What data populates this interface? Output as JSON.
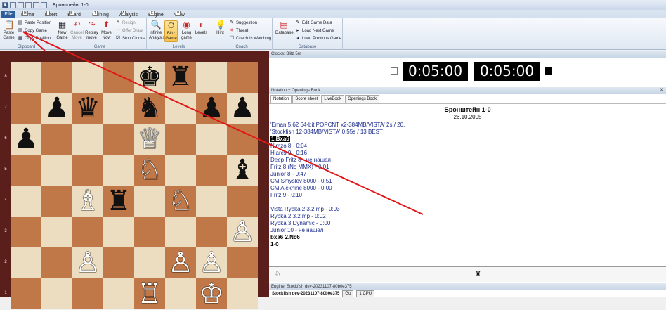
{
  "app": {
    "title": "Бронштейн, 1-0"
  },
  "ribbon_tabs": [
    {
      "label": "Home",
      "key": "H"
    },
    {
      "label": "Insert",
      "key": "I"
    },
    {
      "label": "Board",
      "key": "B"
    },
    {
      "label": "Training",
      "key": "T"
    },
    {
      "label": "Analysis",
      "key": "A"
    },
    {
      "label": "Engine",
      "key": "E"
    },
    {
      "label": "View",
      "key": "V"
    }
  ],
  "file_tab": "File",
  "ribbon": {
    "clipboard": {
      "label": "Clipboard",
      "paste_game": "Paste Game",
      "paste_position": "Paste Position",
      "copy_game": "Copy Game",
      "copy_position": "Copy Position"
    },
    "game": {
      "label": "Game",
      "new_game": "New Game",
      "cancel_move": "Cancel Move",
      "replay_move": "Replay move",
      "move_now": "Move Now",
      "resign": "Resign",
      "offer_draw": "Offer Draw",
      "stop_clocks": "Stop Clocks"
    },
    "levels": {
      "label": "Levels",
      "infinite": "Infinite Analysis",
      "blitz": "Blitz Game",
      "long": "Long game",
      "levels": "Levels"
    },
    "coach": {
      "label": "Coach",
      "hint": "Hint",
      "suggestion": "Suggestion",
      "threat": "Threat",
      "watching": "Coach Is Watching"
    },
    "database": {
      "label": "Database",
      "database": "Database",
      "edit": "Edit Game Data",
      "load_next": "Load Next Game",
      "load_prev": "Load Previous Game"
    }
  },
  "clocks": {
    "header": "Clocks: Blitz 5m",
    "white": "0:05:00",
    "black": "0:05:00"
  },
  "notation": {
    "header": "Notation + Openings Book",
    "tabs": [
      "Notation",
      "Score sheet",
      "LiveBook",
      "Openings Book"
    ],
    "game": "Бронштейн  1-0",
    "date": "26.10.2005",
    "lines": [
      "'Eman 5.62 64-bit POPCNT x2-384MB/VISTA'   2s / 20,",
      "'Stockfish 12-384MB/VISTA'   0.55s / 13     BEST",
      "1.Bxa6",
      "Nimzo 8 - 0:04",
      "Hiarcs 9 - 0:16",
      "Deep Fritz 8 - не нашел",
      "Fritz 8 (No MMX) - 0:01",
      "Junior 8 - 0:47",
      "CM Smyslov 8000 - 0:51",
      "CM Alekhine 8000 - 0:00",
      "Fritz 9 - 0:10",
      "",
      "Vista Rybka 2.3.2 mp - 0:03",
      "Rybka 2.3.2 mp - 0:02",
      "Rybka 3 Dynamic - 0:00",
      "Junior 10 - не нашел",
      "bxa6    2.Nc6",
      "1-0"
    ]
  },
  "engine": {
    "header": "Engine: Stockfish dev-20231107-80b0e375",
    "name": "Stockfish dev-20231107-80b0e375",
    "go": "Go",
    "cpu": "1 CPU"
  },
  "board": {
    "ranks": [
      "8",
      "7",
      "6",
      "5",
      "4",
      "3",
      "2",
      "1"
    ],
    "pieces": [
      {
        "sq": "e8",
        "p": "♚",
        "c": "b"
      },
      {
        "sq": "f8",
        "p": "♜",
        "c": "b"
      },
      {
        "sq": "b7",
        "p": "♟",
        "c": "b"
      },
      {
        "sq": "c7",
        "p": "♛",
        "c": "b"
      },
      {
        "sq": "e7",
        "p": "♞",
        "c": "b"
      },
      {
        "sq": "g7",
        "p": "♟",
        "c": "b"
      },
      {
        "sq": "h7",
        "p": "♟",
        "c": "b"
      },
      {
        "sq": "a6",
        "p": "♟",
        "c": "b"
      },
      {
        "sq": "e6",
        "p": "♕",
        "c": "w"
      },
      {
        "sq": "e5",
        "p": "♘",
        "c": "w"
      },
      {
        "sq": "h5",
        "p": "♝",
        "c": "b"
      },
      {
        "sq": "c4",
        "p": "♗",
        "c": "w"
      },
      {
        "sq": "d4",
        "p": "♜",
        "c": "b"
      },
      {
        "sq": "f4",
        "p": "♘",
        "c": "w"
      },
      {
        "sq": "h3",
        "p": "♙",
        "c": "w"
      },
      {
        "sq": "c2",
        "p": "♙",
        "c": "w"
      },
      {
        "sq": "f2",
        "p": "♙",
        "c": "w"
      },
      {
        "sq": "g2",
        "p": "♙",
        "c": "w"
      },
      {
        "sq": "e1",
        "p": "♖",
        "c": "w"
      },
      {
        "sq": "g1",
        "p": "♔",
        "c": "w"
      }
    ]
  },
  "colors": {
    "arrow": "#e01818",
    "light_square": "#ecdcc0",
    "dark_square": "#c07848"
  }
}
